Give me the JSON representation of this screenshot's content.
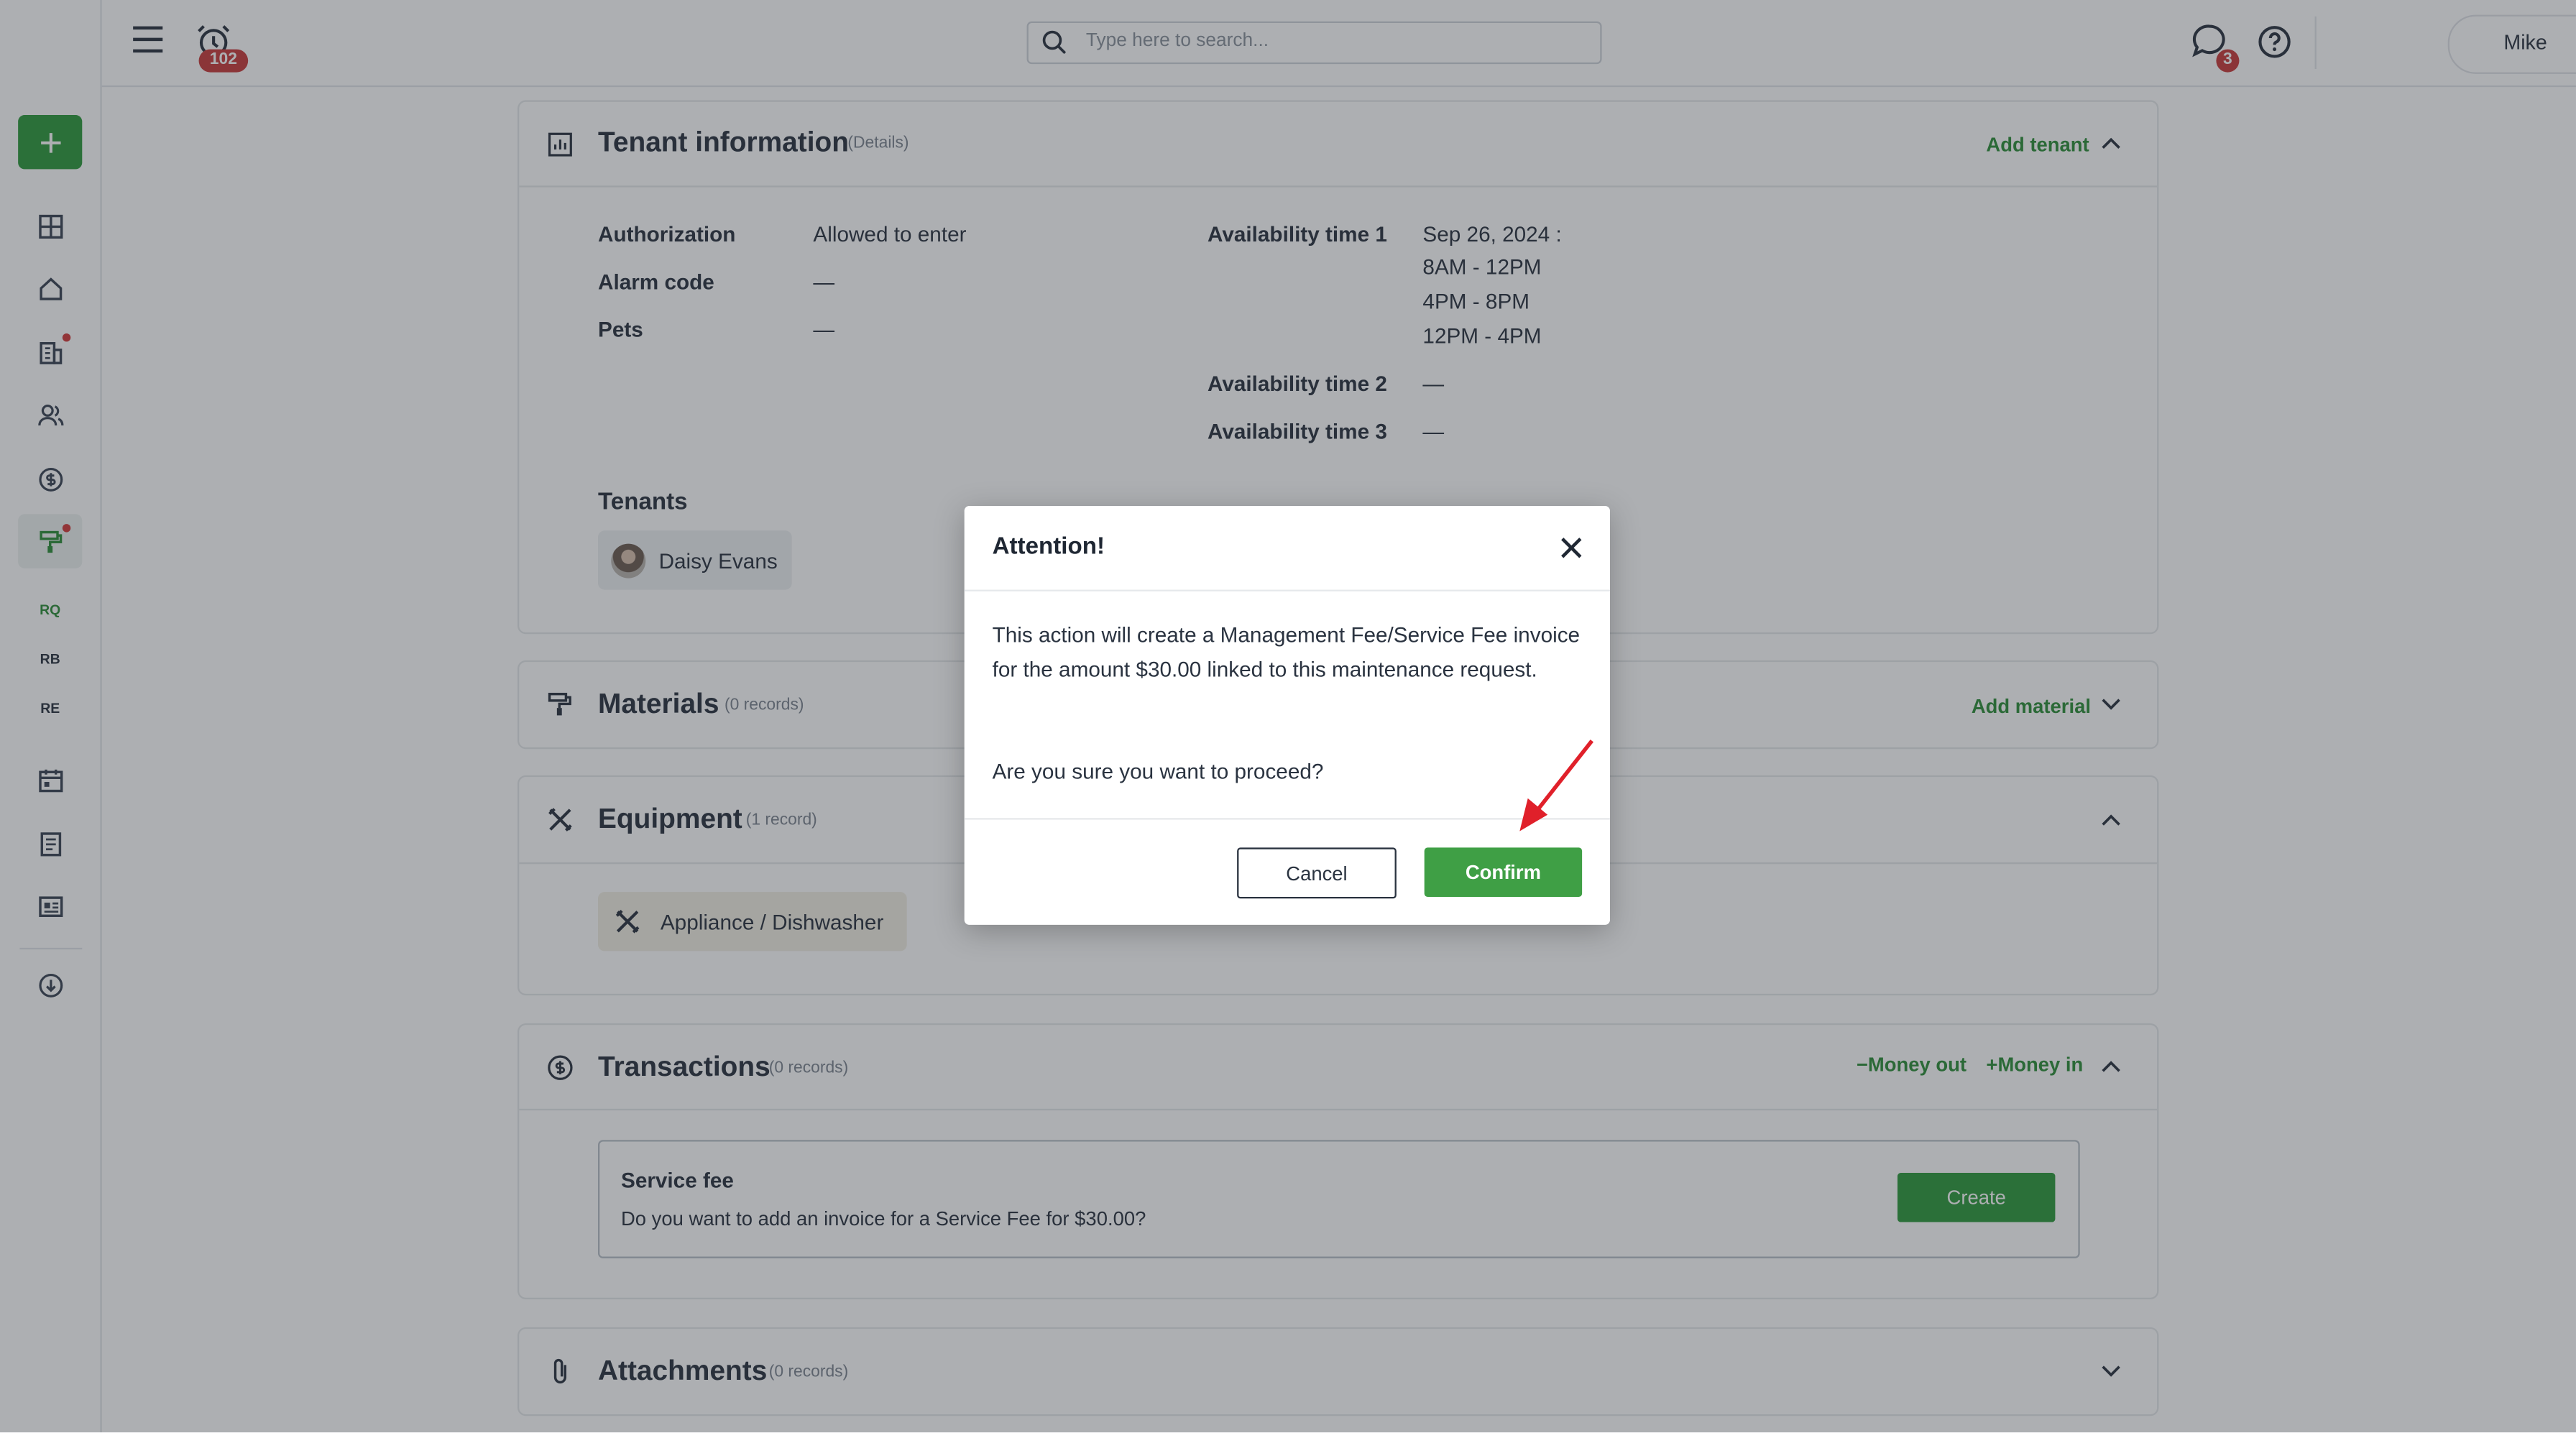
{
  "topbar": {
    "search_placeholder": "Type here to search...",
    "alarm_badge": "102",
    "messages_badge": "3",
    "user_name": "Mike"
  },
  "sidebar": {
    "items": [
      {
        "icon": "dashboard-icon"
      },
      {
        "icon": "home-icon"
      },
      {
        "icon": "buildings-icon"
      },
      {
        "icon": "people-icon"
      },
      {
        "icon": "dollar-icon"
      },
      {
        "icon": "paint-roller-icon"
      },
      {
        "label": "RQ"
      },
      {
        "label": "RB"
      },
      {
        "label": "RE"
      },
      {
        "icon": "calendar-icon"
      },
      {
        "icon": "document-icon"
      },
      {
        "icon": "id-card-icon"
      },
      {
        "icon": "cloud-download-icon"
      }
    ]
  },
  "tenant_info": {
    "title": "Tenant information",
    "subtitle": "(Details)",
    "action": "Add tenant",
    "authorization_label": "Authorization",
    "authorization_value": "Allowed to enter",
    "alarm_label": "Alarm code",
    "alarm_value": "—",
    "pets_label": "Pets",
    "pets_value": "—",
    "avail1_label": "Availability time 1",
    "avail1_lines": [
      "Sep 26, 2024 :",
      "8AM - 12PM",
      "4PM - 8PM",
      "12PM - 4PM"
    ],
    "avail2_label": "Availability time 2",
    "avail2_value": "—",
    "avail3_label": "Availability time 3",
    "avail3_value": "—",
    "tenants_label": "Tenants",
    "tenant_name": "Daisy Evans"
  },
  "materials": {
    "title": "Materials",
    "subtitle": "(0 records)",
    "action": "Add material"
  },
  "equipment": {
    "title": "Equipment",
    "subtitle": "(1 record)",
    "item": "Appliance / Dishwasher"
  },
  "transactions": {
    "title": "Transactions",
    "subtitle": "(0 records)",
    "money_out": "Money out",
    "money_in": "Money in",
    "fee_title": "Service fee",
    "fee_text": "Do you want to add an invoice for a Service Fee for $30.00?",
    "create_label": "Create"
  },
  "attachments": {
    "title": "Attachments",
    "subtitle": "(0 records)"
  },
  "modal": {
    "title": "Attention!",
    "body": "This action will create a Management Fee/Service Fee invoice for the amount $30.00 linked to this maintenance request.",
    "question": "Are you sure you want to proceed?",
    "cancel_label": "Cancel",
    "confirm_label": "Confirm"
  },
  "colors": {
    "accent": "#2e9a3c",
    "badge": "#c83a3a",
    "annotation_arrow": "#e0202a"
  }
}
